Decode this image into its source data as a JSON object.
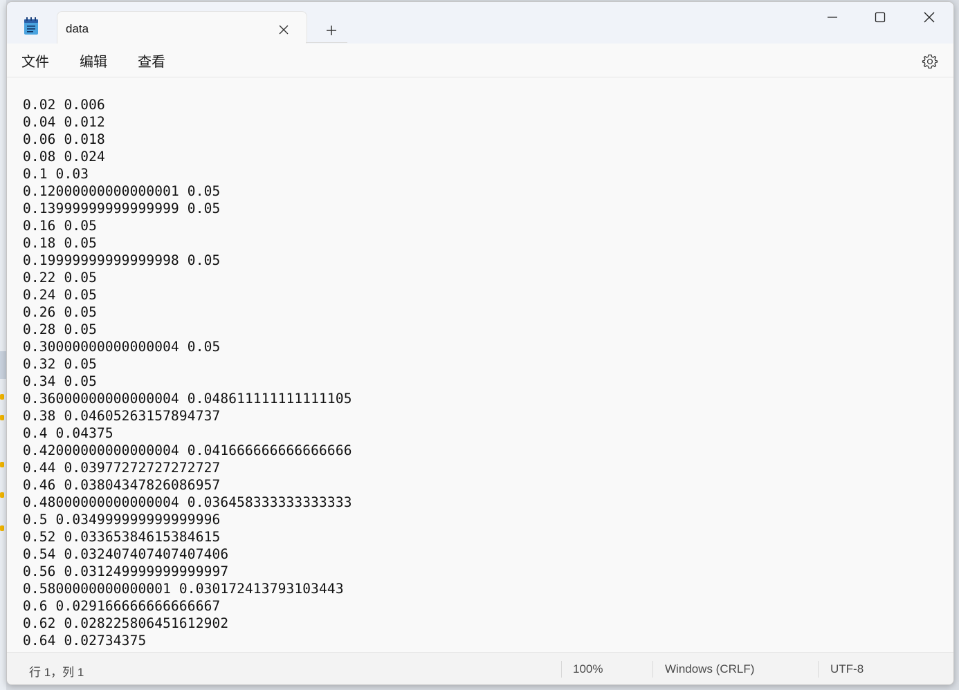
{
  "window": {
    "tab_title": "data",
    "menu": [
      "文件",
      "编辑",
      "查看"
    ]
  },
  "editor": {
    "lines": [
      "0.02 0.006",
      "0.04 0.012",
      "0.06 0.018",
      "0.08 0.024",
      "0.1 0.03",
      "0.12000000000000001 0.05",
      "0.13999999999999999 0.05",
      "0.16 0.05",
      "0.18 0.05",
      "0.19999999999999998 0.05",
      "0.22 0.05",
      "0.24 0.05",
      "0.26 0.05",
      "0.28 0.05",
      "0.30000000000000004 0.05",
      "0.32 0.05",
      "0.34 0.05",
      "0.36000000000000004 0.048611111111111105",
      "0.38 0.04605263157894737",
      "0.4 0.04375",
      "0.42000000000000004 0.041666666666666666",
      "0.44 0.03977272727272727",
      "0.46 0.03804347826086957",
      "0.48000000000000004 0.036458333333333333",
      "0.5 0.034999999999999996",
      "0.52 0.03365384615384615",
      "0.54 0.032407407407407406",
      "0.56 0.031249999999999997",
      "0.5800000000000001 0.030172413793103443",
      "0.6 0.029166666666666667",
      "0.62 0.028225806451612902",
      "0.64 0.02734375"
    ]
  },
  "status": {
    "position": "行 1，列 1",
    "zoom": "100%",
    "line_ending": "Windows (CRLF)",
    "encoding": "UTF-8"
  },
  "icons": {
    "app": "notepad-icon",
    "close_tab": "close-icon",
    "new_tab": "plus-icon",
    "minimize": "minimize-icon",
    "maximize": "maximize-icon",
    "close_window": "close-icon",
    "settings": "gear-icon"
  },
  "colors": {
    "accent": "#1b6ec2",
    "background": "#f9f9f9",
    "titlebar": "#f0f3f9"
  }
}
